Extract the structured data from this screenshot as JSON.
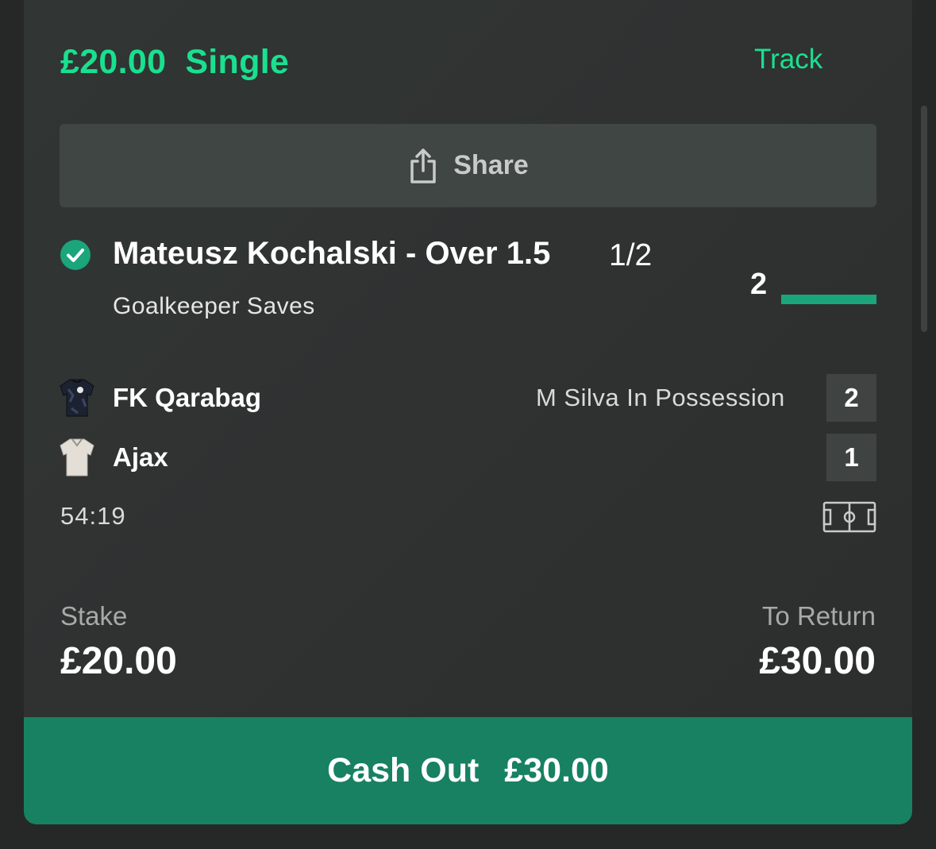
{
  "bet": {
    "stake_title": "£20.00",
    "bet_type": "Single",
    "track_label": "Track"
  },
  "share": {
    "label": "Share",
    "icon": "share-icon"
  },
  "selection": {
    "status_icon": "checkmark-circle-icon",
    "name": "Mateusz Kochalski - Over 1.5",
    "odds": "1/2",
    "market": "Goalkeeper Saves",
    "current_value": "2",
    "progress_fraction": 1.0
  },
  "match": {
    "home_team": "FK Qarabag",
    "away_team": "Ajax",
    "home_score": "2",
    "away_score": "1",
    "status_text": "M Silva In Possession",
    "clock": "54:19",
    "pitch_icon": "pitch-icon"
  },
  "totals": {
    "stake_label": "Stake",
    "stake_value": "£20.00",
    "return_label": "To Return",
    "return_value": "£30.00"
  },
  "cashout": {
    "label": "Cash Out",
    "amount": "£30.00"
  },
  "colors": {
    "accent": "#19e08f",
    "cashout_bg": "#178161",
    "progress": "#1aa57a",
    "card_bg": "#313634",
    "page_bg": "#262727"
  }
}
